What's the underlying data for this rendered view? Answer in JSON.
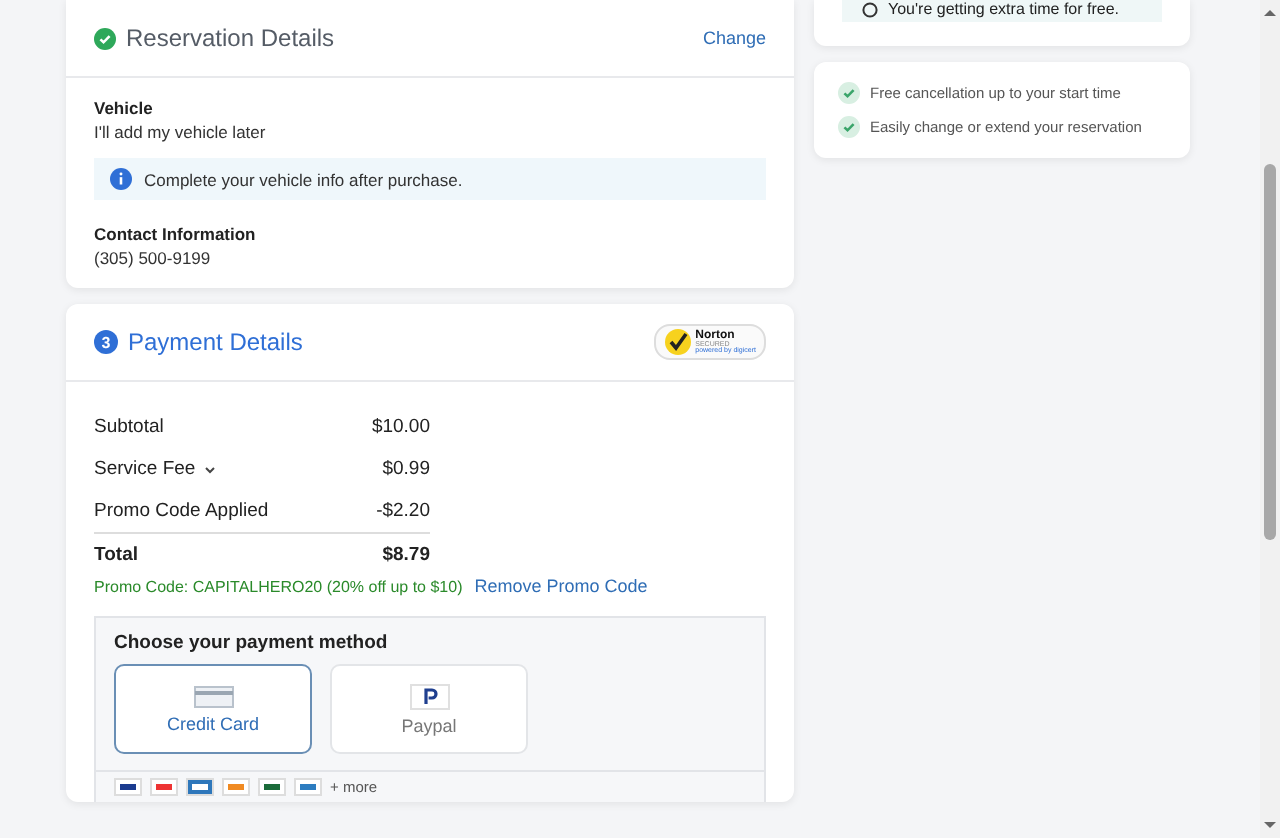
{
  "reservation": {
    "title": "Reservation Details",
    "change_link": "Change",
    "vehicle_label": "Vehicle",
    "vehicle_value": "I'll add my vehicle later",
    "notice": "Complete your vehicle info after purchase.",
    "contact_label": "Contact Information",
    "contact_value": "(305) 500-9199"
  },
  "side_notice": "You're getting extra time for free.",
  "benefits": [
    "Free cancellation up to your start time",
    "Easily change or extend your reservation"
  ],
  "payment": {
    "step": "3",
    "title": "Payment Details",
    "badge": {
      "name": "Norton",
      "sub": "SECURED",
      "powered": "powered by digicert"
    },
    "lines": [
      {
        "label": "Subtotal",
        "amount": "$10.00",
        "expandable": false
      },
      {
        "label": "Service Fee",
        "amount": "$0.99",
        "expandable": true
      },
      {
        "label": "Promo Code Applied",
        "amount": "-$2.20",
        "expandable": false
      }
    ],
    "total_label": "Total",
    "total_amount": "$8.79",
    "promo_note": "Promo Code: CAPITALHERO20 (20% off up to $10)",
    "remove_link": "Remove Promo Code",
    "method_title": "Choose your payment method",
    "methods": [
      {
        "label": "Credit Card",
        "kind": "card",
        "selected": true
      },
      {
        "label": "Paypal",
        "kind": "paypal",
        "selected": false
      }
    ],
    "more_cards": "+ more"
  }
}
